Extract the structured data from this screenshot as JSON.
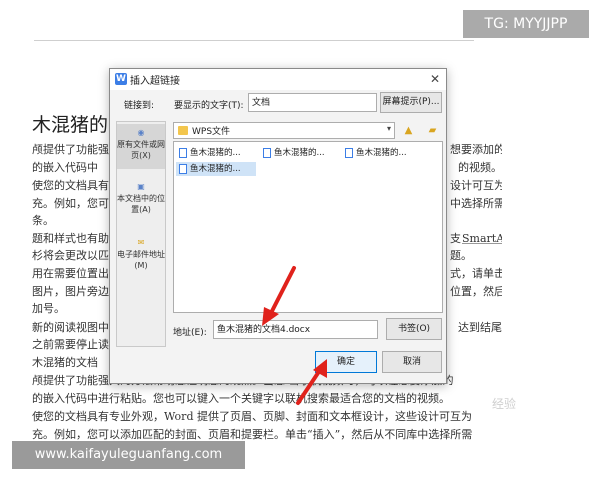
{
  "background_doc": {
    "title": "木混猪的",
    "lines": [
      "颅提供了功能强",
      "的嵌入代码中",
      "使您的文档具有",
      "充。例如，您可",
      "条。",
      "题和样式也有助",
      "杉将会更改以匹",
      "用在需要位置出",
      "图片，图片旁边",
      "加号。",
      "新的阅读视图中",
      "之前需要停止读",
      "木混猪的文档",
      "颅提供了功能强大的方法帮助您证明您的观点。当您                击联机视频时，可以在想要添加的",
      "的嵌入代码中进行粘贴。您也可以键入一个关键字以联机搜索最适合您的文档的视频。",
      "使您的文档具有专业外观，Word 提供了页眉、页脚、封面和文本框设计，这些设计可互为",
      "充。例如，您可以添加匹配的封面、页眉和提要栏。单击“插入”，然后从不同库中选择所需"
    ],
    "right_fragments": [
      "想要添加的",
      "的视频。",
      "设计可互为",
      "中选择所需",
      "SmartArt",
      "题。",
      "式，请单击",
      "位置，然后",
      "达到结尾"
    ],
    "right_prefix": "支"
  },
  "badges": {
    "tg": "TG: MYYJJPP",
    "url": "www.kaifayuleguanfang.com"
  },
  "watermark": "经验",
  "dialog": {
    "title": "插入超链接",
    "link_to_label": "链接到:",
    "display_text_label": "要显示的文字(T):",
    "display_text_value": "文档",
    "screen_tip_button": "屏幕提示(P)...",
    "sidebar": [
      {
        "label": "原有文件或网页(X)",
        "selected": true
      },
      {
        "label": "本文档中的位置(A)",
        "selected": false
      },
      {
        "label": "电子邮件地址(M)",
        "selected": false
      }
    ],
    "folder": "WPS文件",
    "files": [
      "鱼木混猪的...",
      "鱼木混猪的...",
      "鱼木混猪的...",
      "鱼木混猪的..."
    ],
    "address_label": "地址(E):",
    "address_value": "鱼木混猪的文档4.docx",
    "bookmark_button": "书签(O)",
    "ok_button": "确定",
    "cancel_button": "取消"
  },
  "colors": {
    "annotation_arrow": "#e0221c",
    "selection": "#cfe3f7",
    "ok_border": "#0078d7"
  }
}
